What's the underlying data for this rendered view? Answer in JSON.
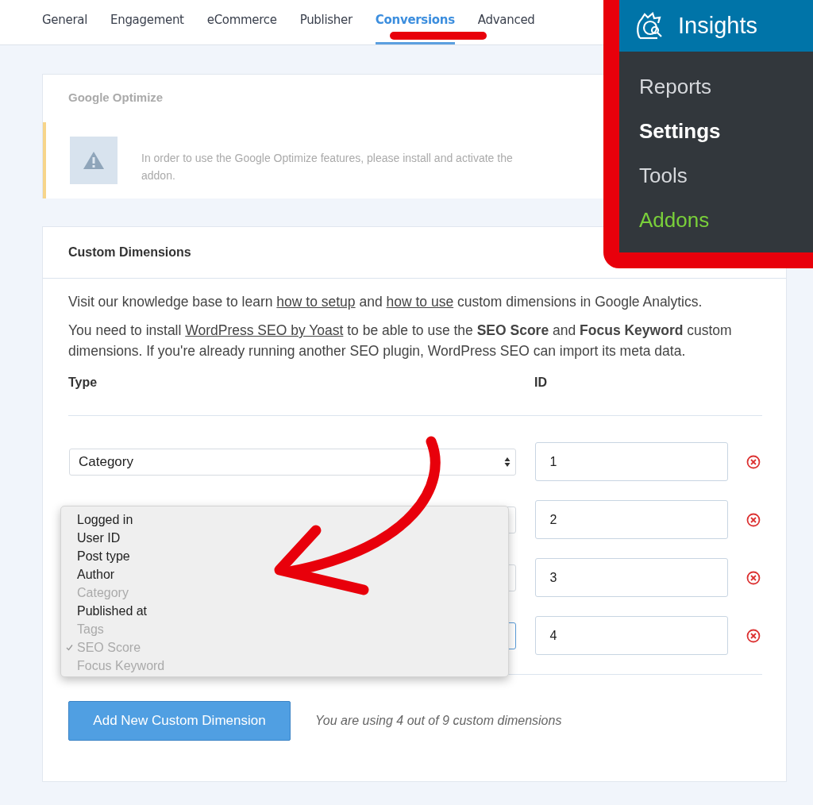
{
  "tabs": [
    {
      "label": "General",
      "selected": false
    },
    {
      "label": "Engagement",
      "selected": false
    },
    {
      "label": "eCommerce",
      "selected": false
    },
    {
      "label": "Publisher",
      "selected": false
    },
    {
      "label": "Conversions",
      "selected": true
    },
    {
      "label": "Advanced",
      "selected": false
    }
  ],
  "optimize_card": {
    "title": "Google Optimize",
    "notice_lines": [
      "In order to use the Google Optimize features, please install and activate the",
      "addon."
    ]
  },
  "custom_dimensions": {
    "title": "Custom Dimensions",
    "intro": [
      {
        "kind": "text",
        "text": "Visit our knowledge base to learn "
      },
      {
        "kind": "link",
        "text": "how to setup"
      },
      {
        "kind": "text",
        "text": " and "
      },
      {
        "kind": "link",
        "text": "how to use"
      },
      {
        "kind": "text",
        "text": " custom dimensions in Google Analytics."
      }
    ],
    "note": [
      {
        "kind": "text",
        "text": "You need to install "
      },
      {
        "kind": "link",
        "text": "WordPress SEO by Yoast"
      },
      {
        "kind": "text",
        "text": " to be able to use the **SEO Score** and **Focus Keyword** custom dimensions. If you're already running another SEO plugin, WordPress SEO can import its meta data."
      }
    ],
    "columns": [
      "Type",
      "ID"
    ],
    "rows": [
      {
        "type": "Category",
        "id": "1",
        "focused": false
      },
      {
        "id": "2",
        "focused": false
      },
      {
        "id": "3",
        "focused": false
      },
      {
        "id": "4",
        "focused": true
      }
    ],
    "dropdown_options": [
      {
        "label": "Logged in",
        "disabled": false,
        "checked": false
      },
      {
        "label": "User ID",
        "disabled": false,
        "checked": false
      },
      {
        "label": "Post type",
        "disabled": false,
        "checked": false
      },
      {
        "label": "Author",
        "disabled": false,
        "checked": false
      },
      {
        "label": "Category",
        "disabled": true,
        "checked": false
      },
      {
        "label": "Published at",
        "disabled": false,
        "checked": false
      },
      {
        "label": "Tags",
        "disabled": true,
        "checked": false
      },
      {
        "label": "SEO Score",
        "disabled": true,
        "checked": true
      },
      {
        "label": "Focus Keyword",
        "disabled": true,
        "checked": false
      }
    ],
    "add_button": "Add New Custom Dimension",
    "usage": "You are using 4 out of 9 custom dimensions"
  },
  "insights_menu": {
    "title": "Insights",
    "items": [
      {
        "label": "Reports",
        "selected": false,
        "color": "#d6d8dc"
      },
      {
        "label": "Settings",
        "selected": true,
        "color": "#ffffff"
      },
      {
        "label": "Tools",
        "selected": false,
        "color": "#d6d8dc"
      },
      {
        "label": "Addons",
        "selected": false,
        "color": "#7ad03a"
      }
    ]
  }
}
